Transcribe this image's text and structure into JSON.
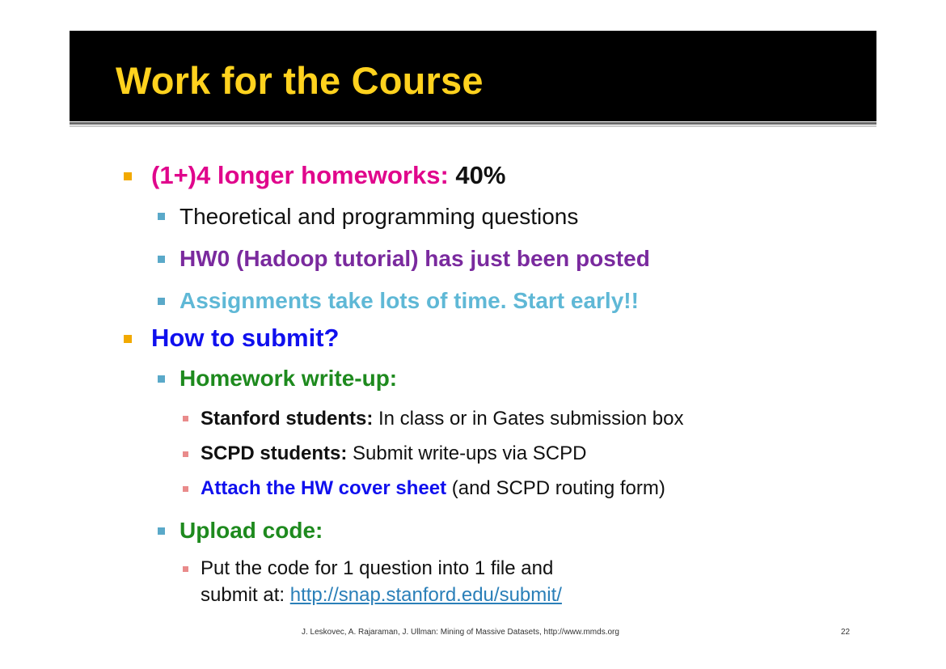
{
  "title": "Work for the Course",
  "items": {
    "hw": {
      "label": "(1+)4 longer homeworks:",
      "value": "40%"
    },
    "theory": "Theoretical and programming questions",
    "hw0": "HW0 (Hadoop tutorial) has just been posted",
    "assign": "Assignments take lots of time. Start early!!",
    "submit": "How to submit?",
    "writeup": "Homework write-up:",
    "stanford": {
      "label": "Stanford students:",
      "text": " In class or in Gates submission box"
    },
    "scpd": {
      "label": "SCPD students:",
      "text": " Submit write-ups via SCPD"
    },
    "attach": {
      "label": "Attach the HW cover sheet",
      "text": " (and SCPD routing form)"
    },
    "upload": "Upload code:",
    "put1": "Put  the code for 1 question into 1 file and",
    "put2": "submit at: ",
    "url": "http://snap.stanford.edu/submit/"
  },
  "footer": "J. Leskovec, A. Rajaraman, J. Ullman: Mining of Massive Datasets, http://www.mmds.org",
  "page_number": "22",
  "colors": {
    "title": "#ffd21e",
    "title_bg": "#000000",
    "bullet_l1": "#f2a900",
    "bullet_l2": "#5aa9c9",
    "bullet_l3": "#e98b8b",
    "magenta": "#e0068c",
    "purple": "#7a2a9e",
    "teal": "#5fb8d6",
    "blue": "#1010ee",
    "green": "#1e8a1e"
  }
}
